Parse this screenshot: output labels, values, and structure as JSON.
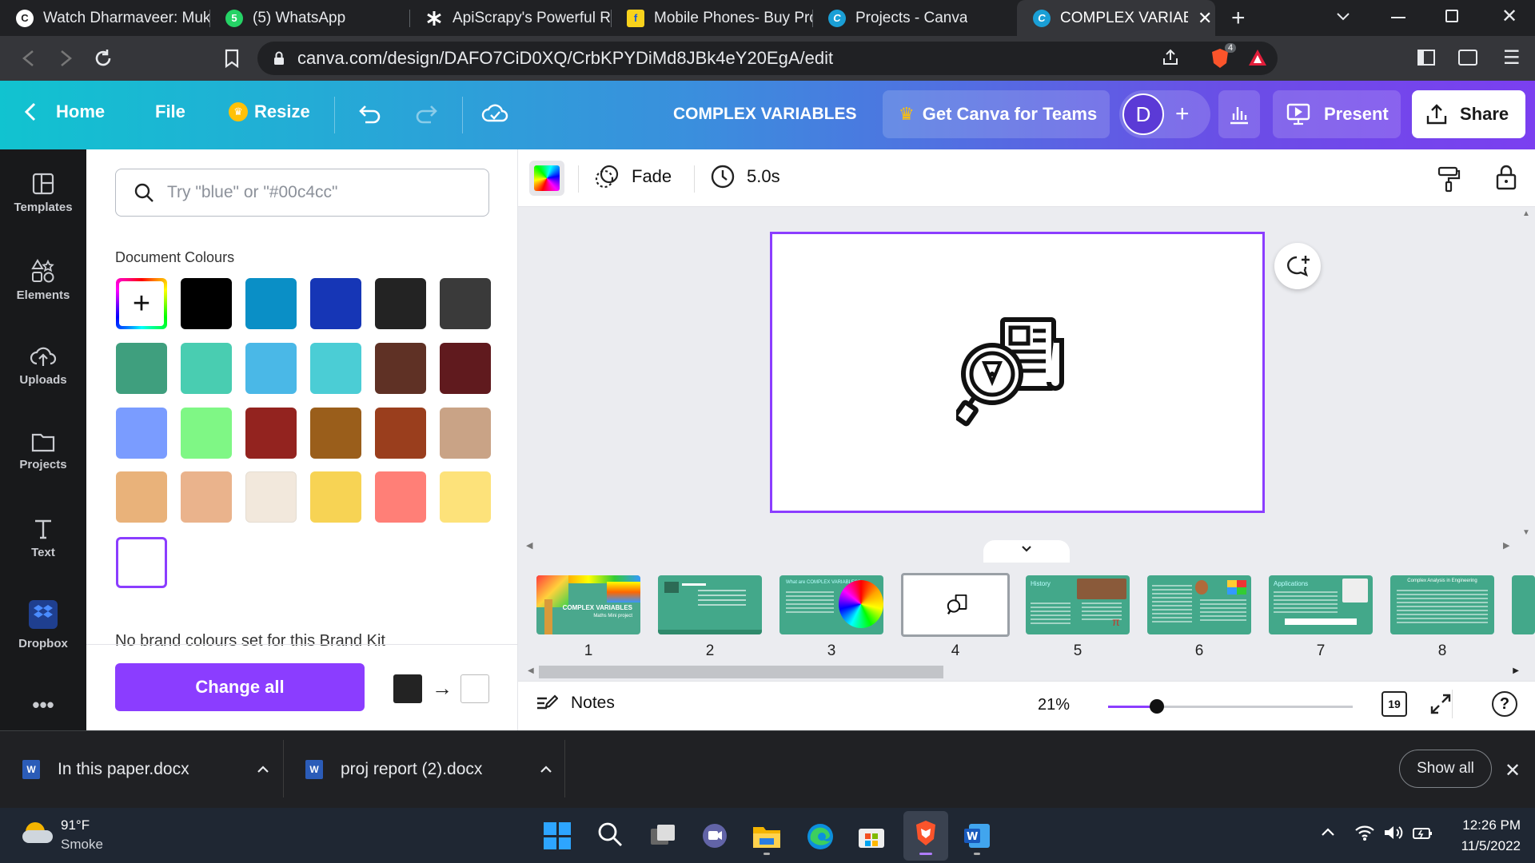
{
  "browser": {
    "tabs": [
      {
        "title": "Watch Dharmaveer: Muk",
        "icon": "channel-icon",
        "color": "#ffffff"
      },
      {
        "title": "(5) WhatsApp",
        "icon": "whatsapp-icon",
        "color": "#25d366",
        "badge": "5"
      },
      {
        "title": "ApiScrapy's Powerful Rea",
        "icon": "apiscrapy-icon",
        "color": "#ffffff"
      },
      {
        "title": "Mobile Phones- Buy Proc",
        "icon": "flipkart-icon",
        "color": "#f8d21c"
      },
      {
        "title": "Projects - Canva",
        "icon": "canva-icon",
        "color": "#00c4cc"
      },
      {
        "title": "COMPLEX VARIABLE",
        "icon": "canva-icon",
        "color": "#00c4cc",
        "active": true
      }
    ],
    "url": "canva.com/design/DAFO7CiD0XQ/CrbKPYDiMd8JBk4eY20EgA/edit",
    "brave_badge": "4"
  },
  "canva_header": {
    "home": "Home",
    "file": "File",
    "resize": "Resize",
    "doc_title": "COMPLEX VARIABLES",
    "teams": "Get Canva for Teams",
    "avatar": "D",
    "present": "Present",
    "share": "Share"
  },
  "rail": [
    {
      "label": "Templates",
      "icon": "templates-icon"
    },
    {
      "label": "Elements",
      "icon": "elements-icon"
    },
    {
      "label": "Uploads",
      "icon": "uploads-icon"
    },
    {
      "label": "Projects",
      "icon": "projects-icon"
    },
    {
      "label": "Text",
      "icon": "text-icon"
    },
    {
      "label": "Dropbox",
      "icon": "dropbox-icon"
    }
  ],
  "panel": {
    "search_placeholder": "Try \"blue\" or \"#00c4cc\"",
    "section_title": "Document Colours",
    "colours": [
      "#000000",
      "#0a8fc6",
      "#1636b6",
      "#232323",
      "#3a3a3a",
      "#3f9f7e",
      "#49cdb1",
      "#4ab8e7",
      "#4bcdd5",
      "#5f3125",
      "#601a1e",
      "#7a9cff",
      "#7ff785",
      "#93231f",
      "#9a5e1b",
      "#9a3e1d",
      "#c9a386",
      "#e9b27a",
      "#eab38c",
      "#f2e8dc",
      "#f7d354",
      "#ff7f77",
      "#fde27a",
      "#ffffff"
    ],
    "no_brand": "No brand colours set for this Brand Kit",
    "change_all": "Change all",
    "from_colour": "#232323",
    "to_colour": "#ffffff"
  },
  "toolbar": {
    "transition": "Fade",
    "duration": "5.0s"
  },
  "thumbnails": [
    {
      "num": "1",
      "title": "COMPLEX VARIABLES",
      "subtitle": "Maths Mini project"
    },
    {
      "num": "2",
      "title": ""
    },
    {
      "num": "3",
      "title": "What are COMPLEX VARIABLES?"
    },
    {
      "num": "4",
      "title": ""
    },
    {
      "num": "5",
      "title": "History"
    },
    {
      "num": "6",
      "title": ""
    },
    {
      "num": "7",
      "title": "Applications"
    },
    {
      "num": "8",
      "title": "Complex Analysis in Engineering"
    }
  ],
  "bottom": {
    "notes": "Notes",
    "zoom": "21%",
    "zoom_fraction": 0.2,
    "page_count": "19"
  },
  "downloads": [
    {
      "name": "In this paper.docx"
    },
    {
      "name": "proj report (2).docx"
    }
  ],
  "show_all": "Show all",
  "taskbar": {
    "temp": "91°F",
    "weather": "Smoke",
    "time": "12:26 PM",
    "date": "11/5/2022"
  }
}
